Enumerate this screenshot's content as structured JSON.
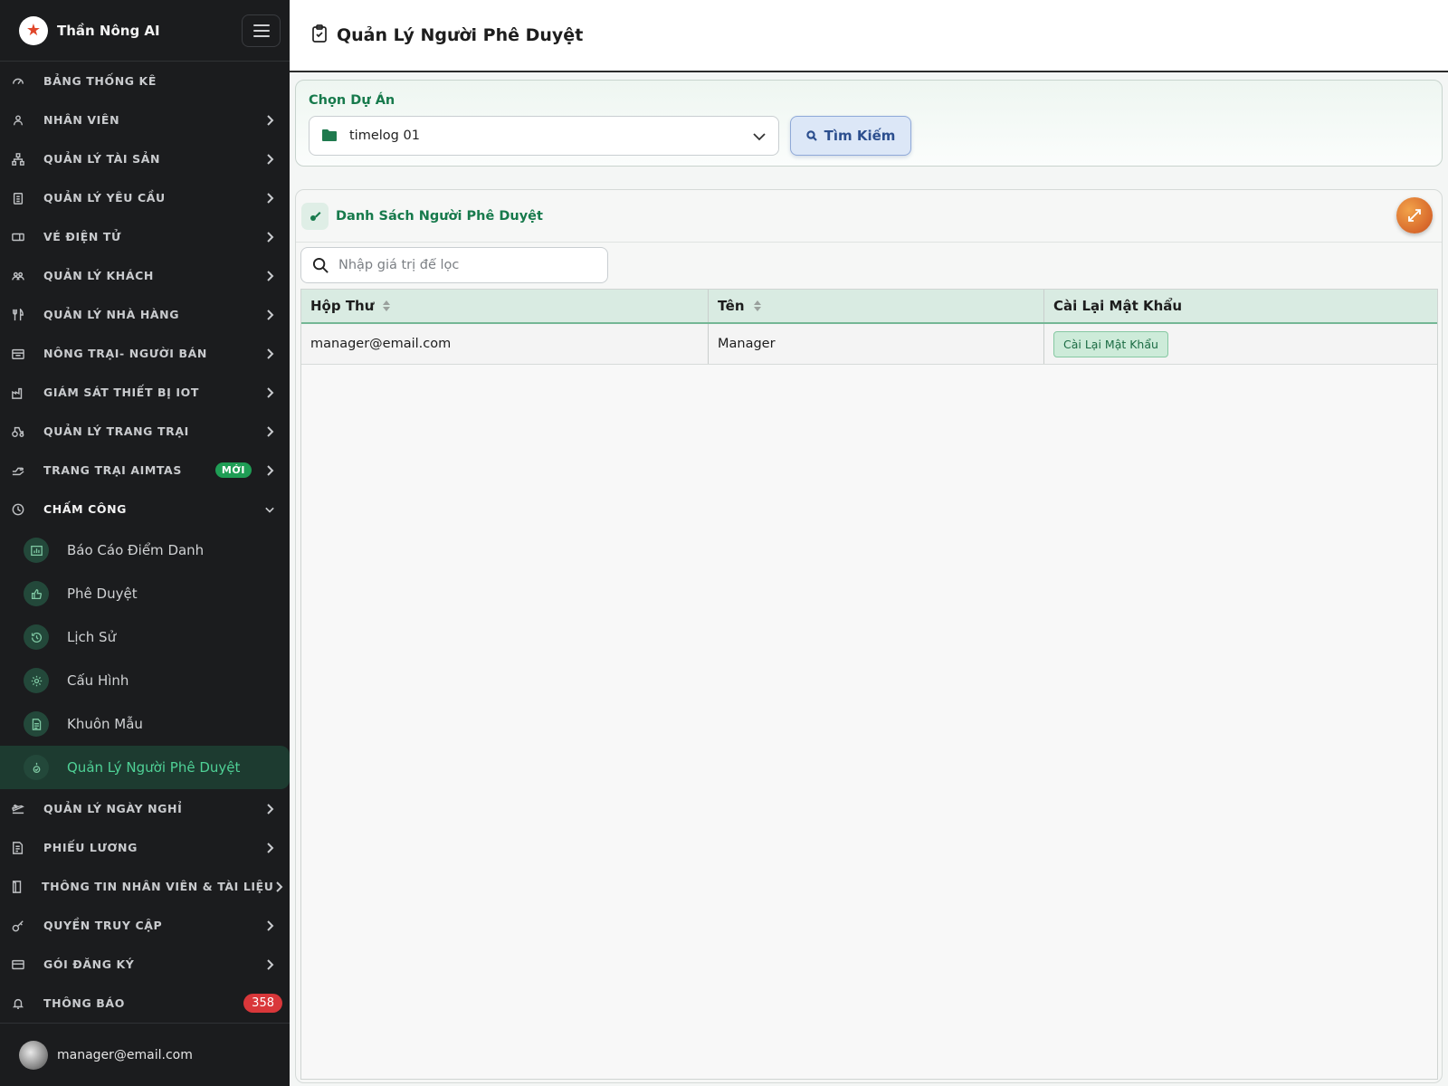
{
  "app": {
    "name": "Thần Nông AI"
  },
  "sidebar": {
    "items": [
      {
        "label": "BẢNG THỐNG KÊ",
        "icon": "gauge-icon",
        "has_children": false
      },
      {
        "label": "NHÂN VIÊN",
        "icon": "people-icon",
        "has_children": true
      },
      {
        "label": "QUẢN LÝ TÀI SẢN",
        "icon": "hierarchy-icon",
        "has_children": true
      },
      {
        "label": "QUẢN LÝ YÊU CẦU",
        "icon": "clipboard-icon",
        "has_children": true
      },
      {
        "label": "VÉ ĐIỆN TỬ",
        "icon": "ticket-icon",
        "has_children": true
      },
      {
        "label": "QUẢN LÝ KHÁCH",
        "icon": "guests-icon",
        "has_children": true
      },
      {
        "label": "QUẢN LÝ NHÀ HÀNG",
        "icon": "utensils-icon",
        "has_children": true
      },
      {
        "label": "NÔNG TRẠI- NGƯỜI BÁN",
        "icon": "store-icon",
        "has_children": true
      },
      {
        "label": "GIÁM SÁT THIẾT BỊ IOT",
        "icon": "factory-icon",
        "has_children": true
      },
      {
        "label": "QUẢN LÝ TRANG TRẠI",
        "icon": "tractor-icon",
        "has_children": true
      },
      {
        "label": "TRANG TRẠI AIMTAS",
        "icon": "hand-icon",
        "has_children": true,
        "badge": "MỚI"
      },
      {
        "label": "CHẤM CÔNG",
        "icon": "clock-icon",
        "has_children": true,
        "expanded": true
      }
    ],
    "sub_items": [
      {
        "label": "Báo Cáo Điểm Danh",
        "icon": "bar-chart-icon"
      },
      {
        "label": "Phê Duyệt",
        "icon": "thumbs-up-icon"
      },
      {
        "label": "Lịch Sử",
        "icon": "history-icon"
      },
      {
        "label": "Cấu Hình",
        "icon": "gear-icon"
      },
      {
        "label": "Khuôn Mẫu",
        "icon": "document-icon"
      },
      {
        "label": "Quản Lý Người Phê Duyệt",
        "icon": "user-check-icon",
        "active": true
      }
    ],
    "items_after": [
      {
        "label": "QUẢN LÝ NGÀY NGHỈ",
        "icon": "plane-icon",
        "has_children": true
      },
      {
        "label": "PHIẾU LƯƠNG",
        "icon": "payslip-icon",
        "has_children": true
      },
      {
        "label": "THÔNG TIN NHÂN VIÊN & TÀI LIỆU",
        "icon": "book-icon",
        "has_children": true
      },
      {
        "label": "QUYỀN TRUY CẬP",
        "icon": "key-icon",
        "has_children": true
      },
      {
        "label": "GÓI ĐĂNG KÝ",
        "icon": "card-icon",
        "has_children": true
      },
      {
        "label": "THÔNG BÁO",
        "icon": "bell-icon",
        "has_children": false,
        "count": "358"
      }
    ],
    "user_email": "manager@email.com"
  },
  "header": {
    "title": "Quản Lý Người Phê Duyệt"
  },
  "project": {
    "label": "Chọn Dự Án",
    "selected": "timelog 01",
    "search_label": "Tìm Kiếm"
  },
  "list": {
    "title": "Danh Sách Người Phê Duyệt",
    "filter_placeholder": "Nhập giá trị để lọc",
    "columns": [
      "Hộp Thư",
      "Tên",
      "Cài Lại Mật Khẩu"
    ],
    "rows": [
      {
        "email": "manager@email.com",
        "name": "Manager",
        "action": "Cài Lại Mật Khẩu"
      }
    ]
  },
  "colors": {
    "accent_green": "#177a4c",
    "sidebar_bg": "#1b1c1e",
    "active_text": "#4fd196",
    "badge_red": "#d9373a",
    "badge_green": "#1f9d55"
  }
}
